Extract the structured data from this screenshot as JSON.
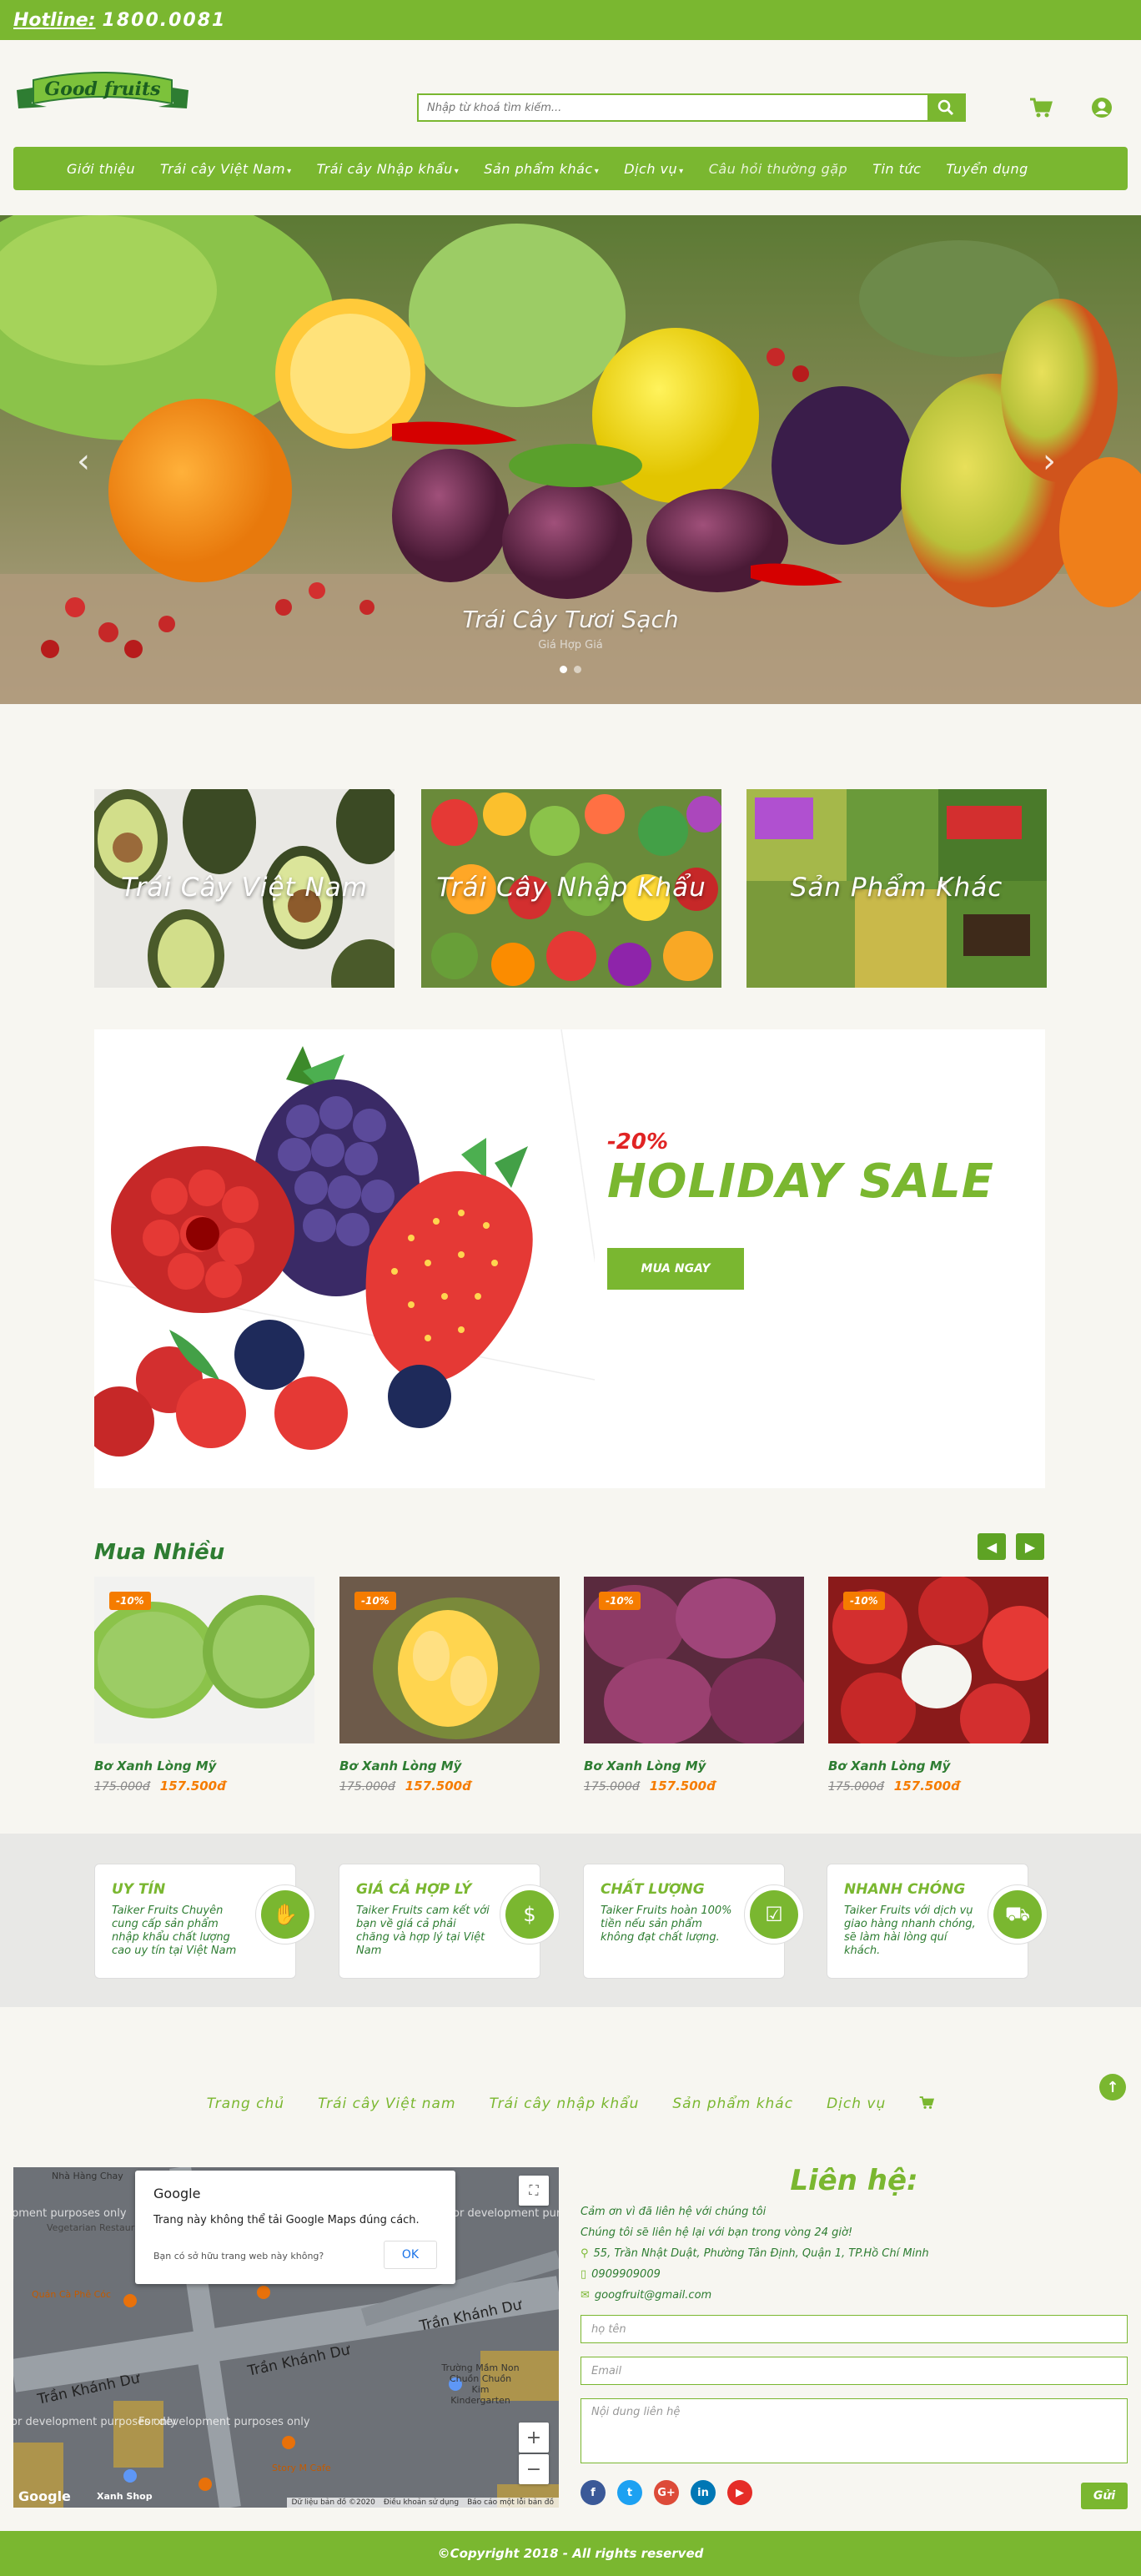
{
  "topbar": {
    "hotline_label": "Hotline:",
    "hotline_number": "1800.0081"
  },
  "header": {
    "logo_text": "Good fruits",
    "search_placeholder": "Nhập từ khoá tìm kiếm..."
  },
  "nav": {
    "items": [
      {
        "label": "Giới thiệu",
        "dropdown": false
      },
      {
        "label": "Trái cây Việt Nam",
        "dropdown": true
      },
      {
        "label": "Trái cây Nhập khẩu",
        "dropdown": true
      },
      {
        "label": "Sản phẩm khác",
        "dropdown": true
      },
      {
        "label": "Dịch vụ",
        "dropdown": true
      },
      {
        "label": "Câu hỏi thường gặp",
        "dropdown": false
      },
      {
        "label": "Tin tức",
        "dropdown": false
      },
      {
        "label": "Tuyển dụng",
        "dropdown": false
      }
    ]
  },
  "hero": {
    "title": "Trái Cây Tươi Sạch",
    "subtitle": "Giá Hợp Giá",
    "slides": 2,
    "active_slide": 1
  },
  "categories": [
    {
      "label": "Trái Cây Việt Nam"
    },
    {
      "label": "Trái Cây Nhập Khẩu"
    },
    {
      "label": "Sản Phẩm Khác"
    }
  ],
  "sale": {
    "percent": "-20%",
    "title": "HOLIDAY SALE",
    "button": "MUA NGAY"
  },
  "products": {
    "title": "Mua Nhiều",
    "items": [
      {
        "badge": "-10%",
        "name": "Bơ Xanh Lòng Mỹ",
        "old_price": "175.000đ",
        "new_price": "157.500đ",
        "image": "green-avocado"
      },
      {
        "badge": "-10%",
        "name": "Bơ Xanh Lòng Mỹ",
        "old_price": "175.000đ",
        "new_price": "157.500đ",
        "image": "durian"
      },
      {
        "badge": "-10%",
        "name": "Bơ Xanh Lòng Mỹ",
        "old_price": "175.000đ",
        "new_price": "157.500đ",
        "image": "plums"
      },
      {
        "badge": "-10%",
        "name": "Bơ Xanh Lòng Mỹ",
        "old_price": "175.000đ",
        "new_price": "157.500đ",
        "image": "rambutan"
      }
    ]
  },
  "features": [
    {
      "title": "UY TÍN",
      "desc": "Taiker Fruits Chuyên cung cấp sản phẩm nhập khẩu chất lượng cao uy tín tại Việt Nam",
      "icon": "handshake-icon"
    },
    {
      "title": "GIÁ CẢ HỢP LÝ",
      "desc": "Taiker Fruits cam kết với bạn về giá cả phải chăng và hợp lý tại Việt Nam",
      "icon": "money-bag-icon"
    },
    {
      "title": "CHẤT LƯỢNG",
      "desc": "Taiker Fruits hoàn 100% tiền nếu sản phẩm không đạt chất lượng.",
      "icon": "checklist-icon"
    },
    {
      "title": "NHANH CHÓNG",
      "desc": "Taiker Fruits với dịch vụ giao hàng nhanh chóng, sẽ làm hài lòng quí khách.",
      "icon": "truck-icon"
    }
  ],
  "bottom_nav": [
    "Trang chủ",
    "Trái cây Việt nam",
    "Trái cây nhập khẩu",
    "Sản phẩm khác",
    "Dịch vụ"
  ],
  "map": {
    "dialog_brand": "Google",
    "dialog_message": "Trang này không thể tải Google Maps đúng cách.",
    "dialog_question": "Bạn có sở hữu trang web này không?",
    "dialog_ok": "OK",
    "dev_text": "For development purposes only",
    "streets": [
      "Trần Khánh Dư",
      "Trần Khánh Dư",
      "Trần Khánh Dư"
    ],
    "places": [
      "Nhà Hàng Chay",
      "Vegetarian Restaurant & Vietnamese Tea",
      "Quán Cà Phê Cóc",
      "Trường Mầm Non Chuồn Chuồn Kim Kindergarten",
      "Story M Cafe",
      "Xanh Shop"
    ],
    "footer": [
      "Dữ liệu bản đồ ©2020",
      "Điều khoản sử dụng",
      "Báo cáo một lỗi bản đồ"
    ],
    "logo": "Google"
  },
  "contact": {
    "title": "Liên hệ:",
    "line1": "Cảm ơn vì đã liên hệ với chúng tôi",
    "line2": "Chúng tôi sẽ liên hệ lại với bạn trong vòng 24 giờ!",
    "address": "55, Trần Nhật Duật, Phường Tân Định, Quận 1, TP.Hồ Chí Minh",
    "phone": "0909909009",
    "email": "googfruit@gmail.com",
    "name_placeholder": "họ tên",
    "email_placeholder": "Email",
    "message_placeholder": "Nội dung liên hệ",
    "send": "Gửi",
    "socials": [
      {
        "name": "facebook-icon",
        "glyph": "f",
        "color": "#3b5998"
      },
      {
        "name": "twitter-icon",
        "glyph": "t",
        "color": "#1da1f2"
      },
      {
        "name": "google-plus-icon",
        "glyph": "G+",
        "color": "#dd4b39"
      },
      {
        "name": "linkedin-icon",
        "glyph": "in",
        "color": "#0077b5"
      },
      {
        "name": "youtube-icon",
        "glyph": "▶",
        "color": "#e52d27"
      }
    ]
  },
  "footer": {
    "copyright": "©Copyright 2018 - All rights reserved"
  },
  "colors": {
    "brand_green": "#7ab730",
    "dark_green": "#2e7d32",
    "orange": "#f57c00",
    "sale_red": "#e02424"
  }
}
